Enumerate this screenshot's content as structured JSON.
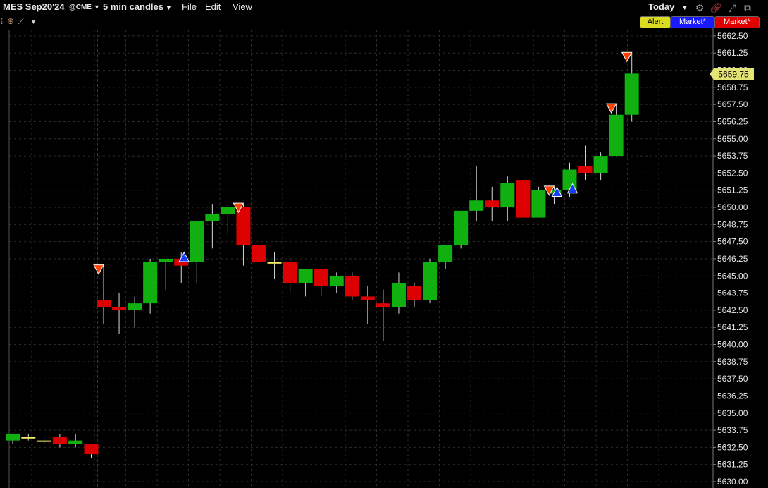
{
  "header": {
    "symbol": "MES Sep20'24",
    "exchange": "@CME",
    "interval": "5 min candles",
    "menus": [
      "File",
      "Edit",
      "View"
    ],
    "period": "Today"
  },
  "order_buttons": [
    "Alert",
    "Market*",
    "Market*"
  ],
  "colors": {
    "up": "#10b010",
    "down": "#dd0000",
    "doji": "#f2ee60",
    "sell_marker": "#ff4000",
    "buy_marker": "#1a3cff",
    "last_price_bg": "#e4e476"
  },
  "last_price": "5659.75",
  "chart_data": {
    "type": "candlestick",
    "ylim": [
      5630.0,
      5663.5
    ],
    "y_ticks": [
      "5662.50",
      "5661.25",
      "5660.00",
      "5658.75",
      "5657.50",
      "5656.25",
      "5655.00",
      "5653.75",
      "5652.50",
      "5651.25",
      "5650.00",
      "5648.75",
      "5647.50",
      "5646.25",
      "5645.00",
      "5643.75",
      "5642.50",
      "5641.25",
      "5640.00",
      "5638.75",
      "5637.50",
      "5636.25",
      "5635.00",
      "5633.75",
      "5632.50",
      "5631.25",
      "5630.00"
    ],
    "candles": [
      {
        "o": 5633.0,
        "h": 5633.5,
        "l": 5632.75,
        "c": 5633.5
      },
      {
        "o": 5633.25,
        "h": 5633.5,
        "l": 5633.0,
        "c": 5633.25
      },
      {
        "o": 5633.0,
        "h": 5633.25,
        "l": 5632.75,
        "c": 5633.0
      },
      {
        "o": 5633.25,
        "h": 5633.5,
        "l": 5632.5,
        "c": 5632.75
      },
      {
        "o": 5632.75,
        "h": 5633.5,
        "l": 5632.5,
        "c": 5633.0
      },
      {
        "o": 5632.75,
        "h": 5632.75,
        "l": 5631.75,
        "c": 5632.0
      },
      {
        "o": 5643.25,
        "h": 5645.75,
        "l": 5641.5,
        "c": 5642.75
      },
      {
        "o": 5642.75,
        "h": 5643.75,
        "l": 5640.75,
        "c": 5642.5
      },
      {
        "o": 5642.5,
        "h": 5643.5,
        "l": 5641.25,
        "c": 5643.0
      },
      {
        "o": 5643.0,
        "h": 5646.25,
        "l": 5642.25,
        "c": 5646.0
      },
      {
        "o": 5646.0,
        "h": 5646.25,
        "l": 5644.0,
        "c": 5646.25
      },
      {
        "o": 5646.25,
        "h": 5646.75,
        "l": 5644.5,
        "c": 5645.75
      },
      {
        "o": 5646.0,
        "h": 5649.0,
        "l": 5644.5,
        "c": 5649.0
      },
      {
        "o": 5649.0,
        "h": 5650.25,
        "l": 5647.0,
        "c": 5649.5
      },
      {
        "o": 5649.5,
        "h": 5650.25,
        "l": 5648.0,
        "c": 5650.0
      },
      {
        "o": 5650.0,
        "h": 5650.25,
        "l": 5645.75,
        "c": 5647.25
      },
      {
        "o": 5647.25,
        "h": 5647.5,
        "l": 5644.0,
        "c": 5646.0
      },
      {
        "o": 5646.0,
        "h": 5646.75,
        "l": 5644.75,
        "c": 5646.0
      },
      {
        "o": 5646.0,
        "h": 5646.25,
        "l": 5643.75,
        "c": 5644.5
      },
      {
        "o": 5644.5,
        "h": 5645.5,
        "l": 5643.5,
        "c": 5645.5
      },
      {
        "o": 5645.5,
        "h": 5645.5,
        "l": 5643.5,
        "c": 5644.25
      },
      {
        "o": 5644.25,
        "h": 5645.25,
        "l": 5643.75,
        "c": 5645.0
      },
      {
        "o": 5645.0,
        "h": 5645.25,
        "l": 5643.25,
        "c": 5643.5
      },
      {
        "o": 5643.5,
        "h": 5644.25,
        "l": 5641.5,
        "c": 5643.25
      },
      {
        "o": 5643.0,
        "h": 5644.0,
        "l": 5640.25,
        "c": 5642.75
      },
      {
        "o": 5642.75,
        "h": 5645.25,
        "l": 5642.25,
        "c": 5644.5
      },
      {
        "o": 5644.25,
        "h": 5644.5,
        "l": 5642.75,
        "c": 5643.25
      },
      {
        "o": 5643.25,
        "h": 5646.25,
        "l": 5643.0,
        "c": 5646.0
      },
      {
        "o": 5646.0,
        "h": 5647.25,
        "l": 5645.5,
        "c": 5647.25
      },
      {
        "o": 5647.25,
        "h": 5649.75,
        "l": 5647.0,
        "c": 5649.75
      },
      {
        "o": 5649.75,
        "h": 5653.0,
        "l": 5649.0,
        "c": 5650.5
      },
      {
        "o": 5650.5,
        "h": 5651.5,
        "l": 5649.0,
        "c": 5650.0
      },
      {
        "o": 5650.0,
        "h": 5652.25,
        "l": 5649.0,
        "c": 5651.75
      },
      {
        "o": 5652.0,
        "h": 5652.0,
        "l": 5649.25,
        "c": 5649.25
      },
      {
        "o": 5649.25,
        "h": 5651.5,
        "l": 5649.25,
        "c": 5651.25
      },
      {
        "o": 5651.0,
        "h": 5651.5,
        "l": 5650.25,
        "c": 5651.25
      },
      {
        "o": 5651.25,
        "h": 5653.25,
        "l": 5650.75,
        "c": 5652.75
      },
      {
        "o": 5653.0,
        "h": 5654.5,
        "l": 5652.0,
        "c": 5652.5
      },
      {
        "o": 5652.5,
        "h": 5654.0,
        "l": 5652.0,
        "c": 5653.75
      },
      {
        "o": 5653.75,
        "h": 5657.5,
        "l": 5653.75,
        "c": 5656.75
      },
      {
        "o": 5656.75,
        "h": 5661.25,
        "l": 5656.25,
        "c": 5659.75
      }
    ],
    "sell_markers_at": [
      6,
      15,
      35,
      39,
      40
    ],
    "buy_markers_at": [
      11,
      35,
      36
    ]
  }
}
